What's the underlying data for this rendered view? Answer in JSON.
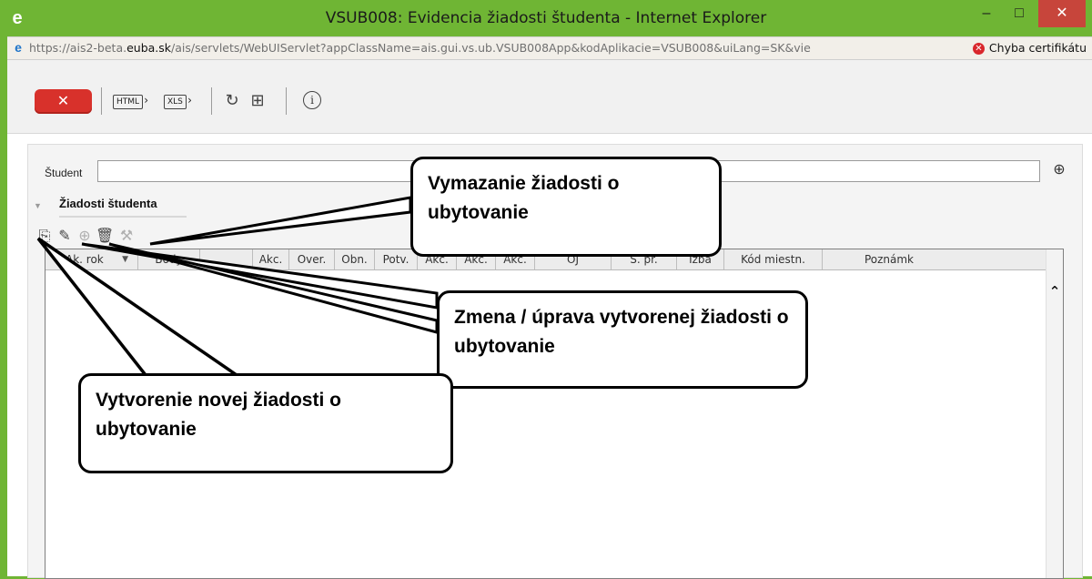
{
  "window": {
    "title": "VSUB008: Evidencia žiadosti študenta - Internet Explorer",
    "minimize_label": "–",
    "maximize_label": "□",
    "close_label": "✕"
  },
  "address_bar": {
    "url_prefix": "https://ais2-beta.",
    "url_domain": "euba.sk",
    "url_rest": "/ais/servlets/WebUIServlet?appClassName=ais.gui.vs.ub.VSUB008App&kodAplikacie=VSUB008&uiLang=SK&vie",
    "cert_error": "Chyba certifikátu"
  },
  "toolbar": {
    "close_label": "✕",
    "html_label": "HTML",
    "xls_label": "XLS",
    "refresh_icon": "↻",
    "layout_icon": "⊞",
    "info_icon": "i"
  },
  "form": {
    "student_label": "Študent",
    "student_value": "",
    "section_title": "Žiadosti študenta"
  },
  "grid": {
    "columns": [
      "Ak. rok",
      "Body",
      "",
      "Akc.",
      "Over.",
      "Obn.",
      "Potv.",
      "Akc.",
      "Akc.",
      "Akc.",
      "OJ",
      "Š. pr.",
      "Izba",
      "Kód miestn.",
      "Poznámk"
    ],
    "rows": []
  },
  "callouts": {
    "delete": "Vymazanie žiadosti o ubytovanie",
    "edit": "Zmena / úprava vytvorenej žiadosti o ubytovanie",
    "create": "Vytvorenie novej žiadosti o ubytovanie"
  }
}
